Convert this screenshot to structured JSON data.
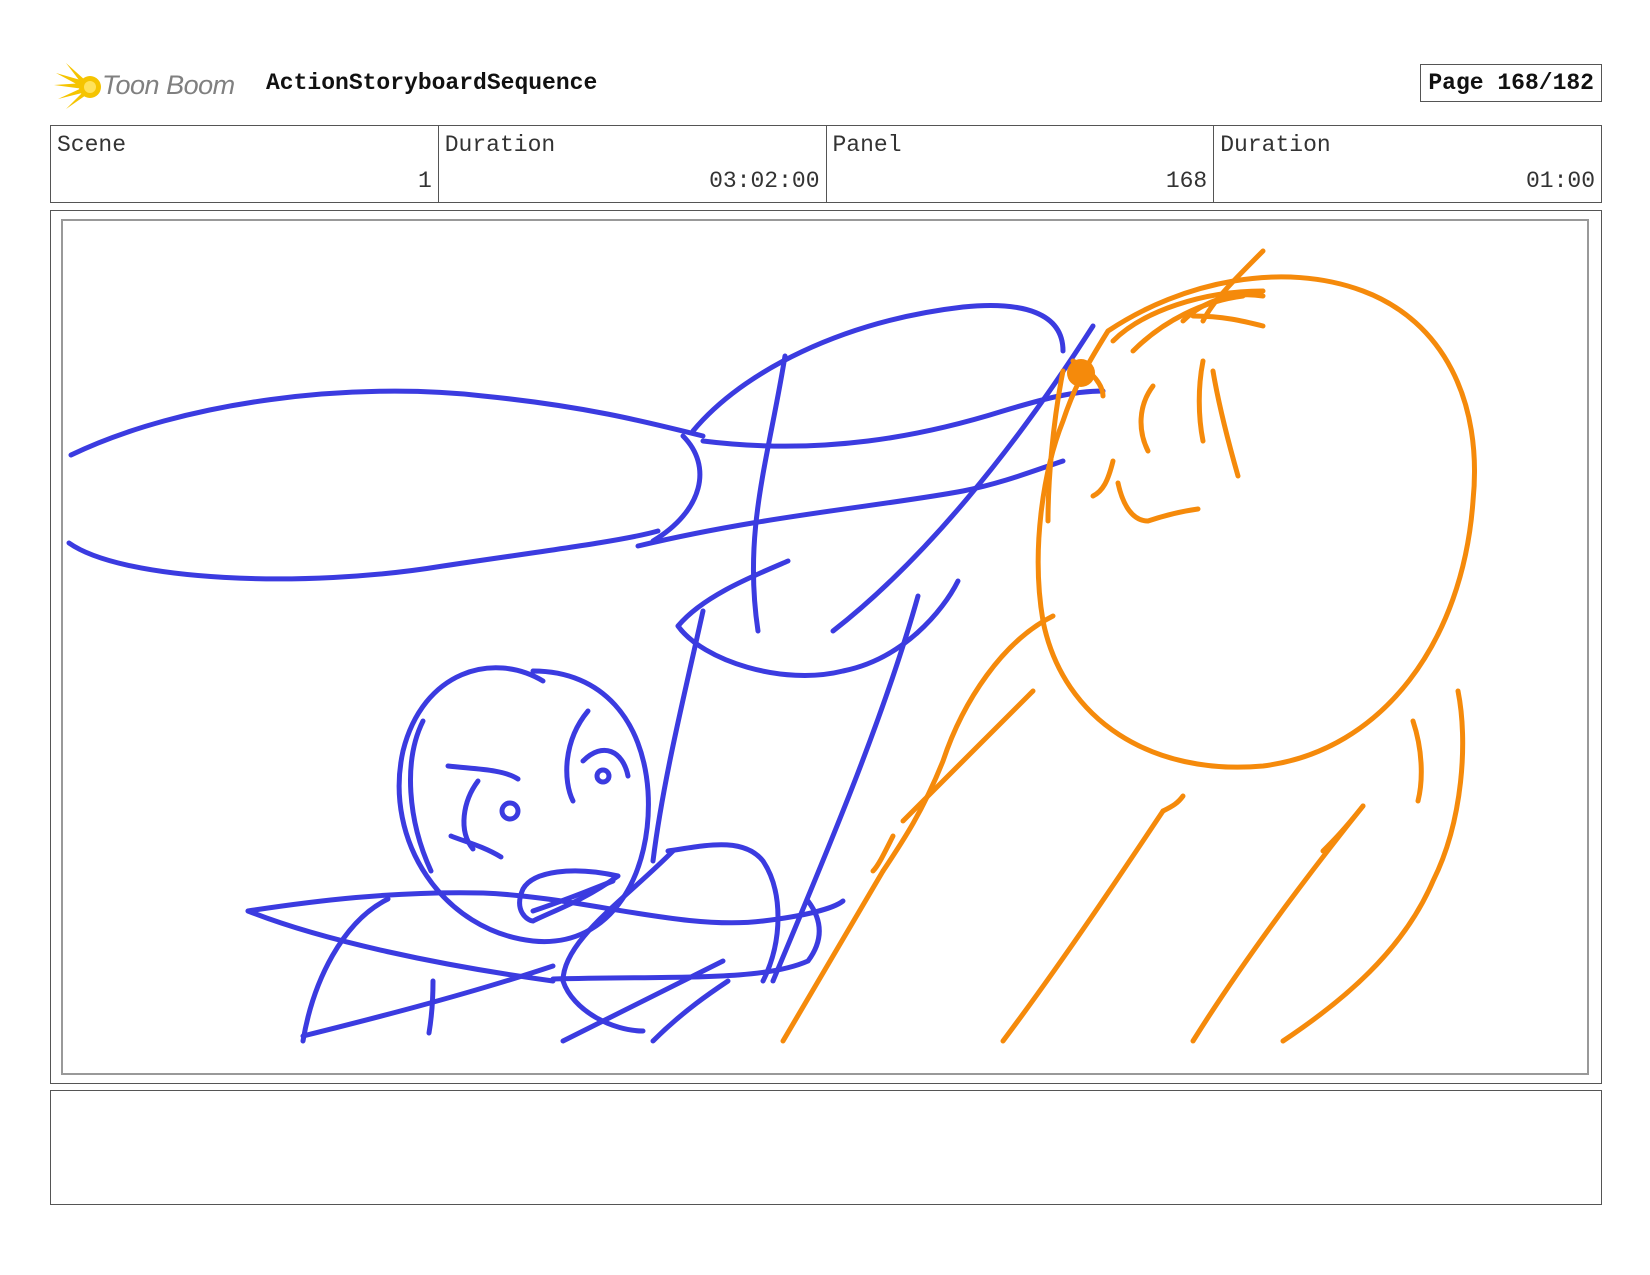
{
  "header": {
    "logo_text": "Toon Boom",
    "sequence_title": "ActionStoryboardSequence",
    "page_label": "Page 168/182"
  },
  "info": {
    "scene_label": "Scene",
    "scene_value": "1",
    "scene_duration_label": "Duration",
    "scene_duration_value": "03:02:00",
    "panel_label": "Panel",
    "panel_value": "168",
    "panel_duration_label": "Duration",
    "panel_duration_value": "01:00"
  },
  "colors": {
    "sketch_blue": "#3b3be0",
    "sketch_orange": "#f58a0b",
    "logo_yellow": "#f5c400"
  },
  "notes": {
    "text": ""
  }
}
